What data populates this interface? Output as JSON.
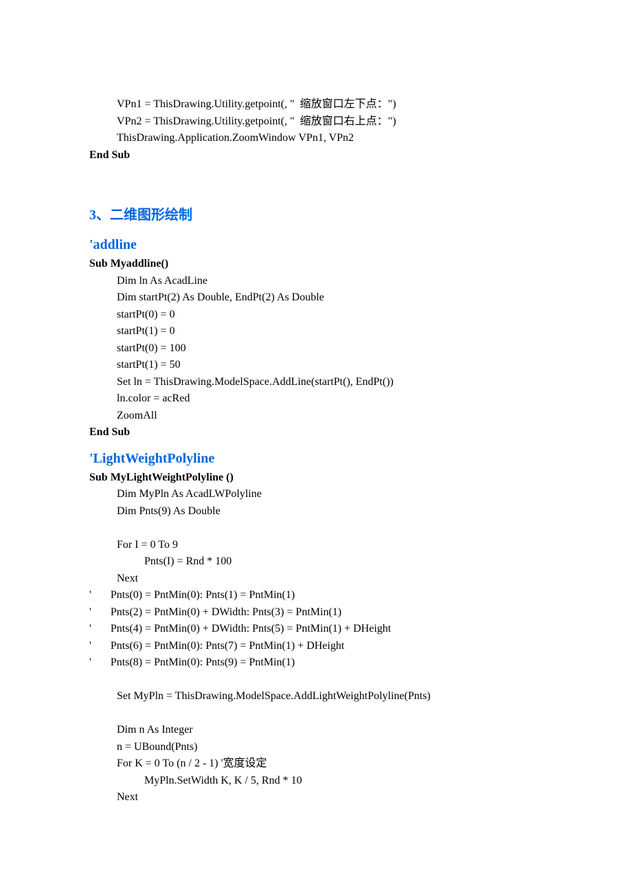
{
  "block1": {
    "l1": "VPn1 = ThisDrawing.Utility.getpoint(, \"  缩放窗口左下点：\")",
    "l2": "VPn2 = ThisDrawing.Utility.getpoint(, \"  缩放窗口右上点：\")",
    "l3": "ThisDrawing.Application.ZoomWindow VPn1, VPn2",
    "l4": "End Sub"
  },
  "section_heading": "3、二维图形绘制",
  "addline": {
    "heading": "'addline",
    "l1": "Sub Myaddline()",
    "l2": "Dim ln As AcadLine",
    "l3": "Dim startPt(2) As Double, EndPt(2) As Double",
    "l4": "startPt(0) = 0",
    "l5": "startPt(1) = 0",
    "l6": "startPt(0) = 100",
    "l7": "startPt(1) = 50",
    "l8": "Set ln = ThisDrawing.ModelSpace.AddLine(startPt(), EndPt())",
    "l9": "ln.color = acRed",
    "l10": "ZoomAll",
    "l11": "End Sub"
  },
  "lwpoly": {
    "heading": "'LightWeightPolyline",
    "l1": "Sub MyLightWeightPolyline ()",
    "l2": "Dim MyPln As AcadLWPolyline",
    "l3": "Dim Pnts(9) As Double",
    "l4": "For I = 0 To 9",
    "l5": "Pnts(I) = Rnd * 100",
    "l6": "Next",
    "l7": "'       Pnts(0) = PntMin(0): Pnts(1) = PntMin(1)",
    "l8": "'       Pnts(2) = PntMin(0) + DWidth: Pnts(3) = PntMin(1)",
    "l9": "'       Pnts(4) = PntMin(0) + DWidth: Pnts(5) = PntMin(1) + DHeight",
    "l10": "'       Pnts(6) = PntMin(0): Pnts(7) = PntMin(1) + DHeight",
    "l11": "'       Pnts(8) = PntMin(0): Pnts(9) = PntMin(1)",
    "l12": "Set MyPln = ThisDrawing.ModelSpace.AddLightWeightPolyline(Pnts)",
    "l13": "Dim n As Integer",
    "l14": "n = UBound(Pnts)",
    "l15": "For K = 0 To (n / 2 - 1) '宽度设定",
    "l16": "MyPln.SetWidth K, K / 5, Rnd * 10",
    "l17": "Next"
  }
}
